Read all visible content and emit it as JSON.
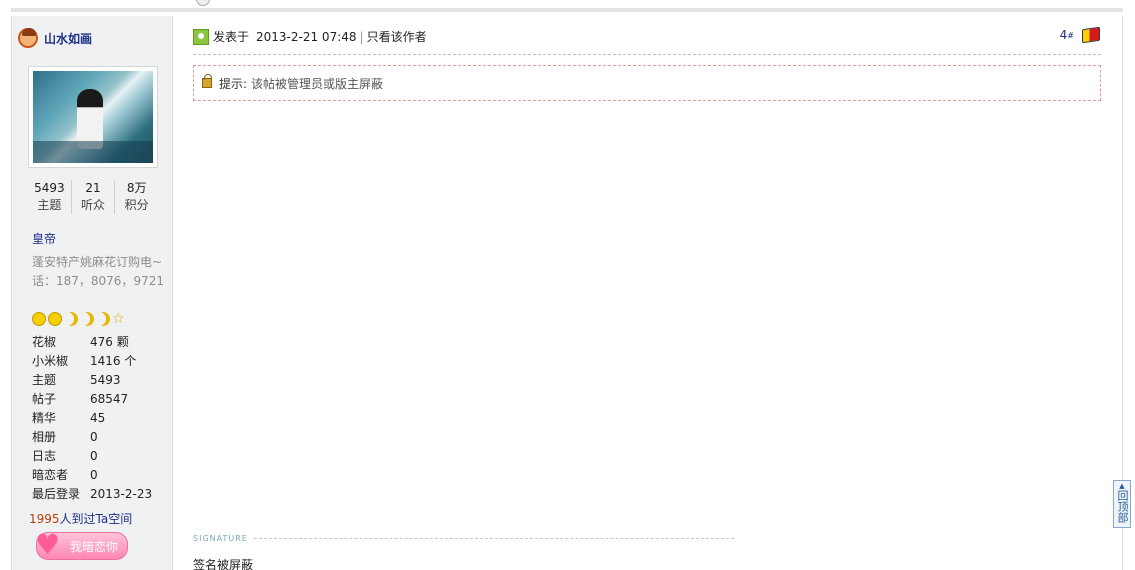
{
  "author": {
    "name": "山水如画",
    "rank": "皇帝",
    "signature_line": "蓬安特产姚麻花订购电~话：187，8076，9721"
  },
  "stats": [
    {
      "value": "5493",
      "label": "主题"
    },
    {
      "value": "21",
      "label": "听众"
    },
    {
      "value": "8万",
      "label": "积分"
    }
  ],
  "profile": [
    {
      "key": "花椒",
      "value": "476 颗"
    },
    {
      "key": "小米椒",
      "value": "1416 个"
    },
    {
      "key": "主题",
      "value": "5493"
    },
    {
      "key": "帖子",
      "value": "68547"
    },
    {
      "key": "精华",
      "value": "45"
    },
    {
      "key": "相册",
      "value": "0"
    },
    {
      "key": "日志",
      "value": "0"
    },
    {
      "key": "暗恋者",
      "value": "0"
    },
    {
      "key": "最后登录",
      "value": "2013-2-23"
    }
  ],
  "visits": {
    "count": "1995",
    "text": "人到过Ta空间"
  },
  "love_button": "我暗恋你",
  "post": {
    "posted_label": "发表于",
    "posted_time": "2013-2-21 07:48",
    "only_author": "只看该作者",
    "floor": "4",
    "floor_suffix": "#"
  },
  "notice": {
    "tip_label": "提示:",
    "text": "该帖被管理员或版主屏蔽"
  },
  "signature": {
    "label": "SIGNATURE",
    "text": "签名被屏蔽"
  },
  "back_to_top": "回顶部"
}
